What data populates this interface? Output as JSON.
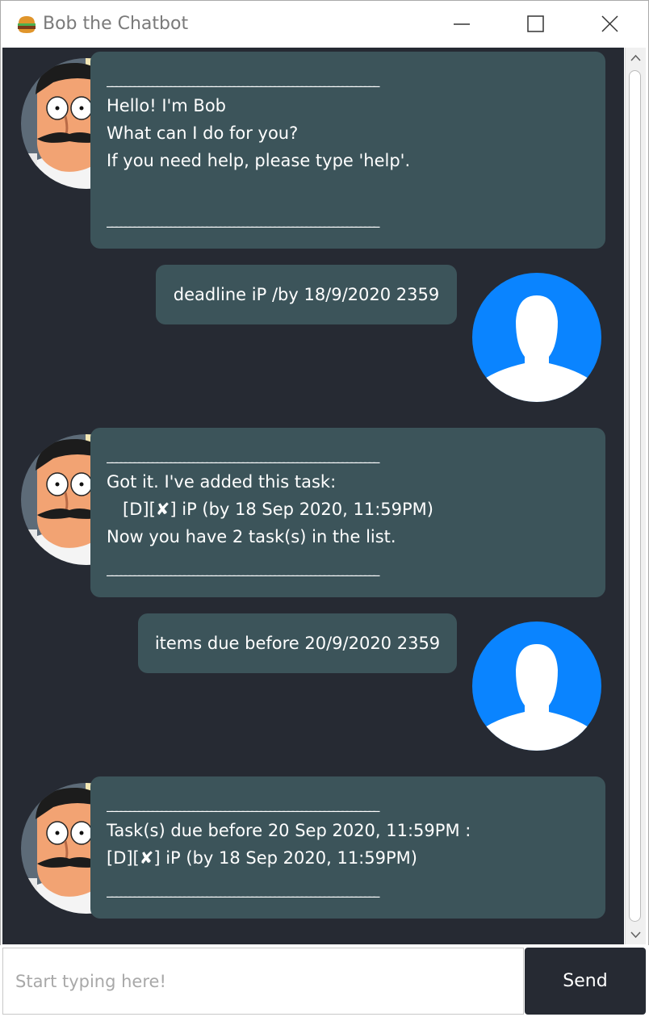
{
  "window": {
    "title": "Bob the Chatbot",
    "app_icon": "burger-icon"
  },
  "messages": [
    {
      "sender": "bot",
      "lines": [
        "Hello! I'm Bob",
        "What can I do for you?",
        "If you need help, please type 'help'.",
        ""
      ],
      "divider": "____________________________________________________________"
    },
    {
      "sender": "user",
      "text": "deadline iP /by 18/9/2020 2359"
    },
    {
      "sender": "bot",
      "lines": [
        "Got it. I've added this task:",
        "   [D][✘] iP (by 18 Sep 2020, 11:59PM)",
        "Now you have 2 task(s) in the list."
      ],
      "divider": "____________________________________________________________"
    },
    {
      "sender": "user",
      "text": "items due before 20/9/2020 2359"
    },
    {
      "sender": "bot",
      "lines": [
        "Task(s) due before 20 Sep 2020, 11:59PM :",
        "[D][✘] iP (by 18 Sep 2020, 11:59PM)"
      ],
      "divider": "____________________________________________________________"
    }
  ],
  "input": {
    "placeholder": "Start typing here!",
    "value": ""
  },
  "send_button": {
    "label": "Send"
  },
  "colors": {
    "chat_background": "#262a33",
    "bubble": "#3c545a",
    "user_avatar": "#0a84ff",
    "send_button": "#262a33"
  }
}
